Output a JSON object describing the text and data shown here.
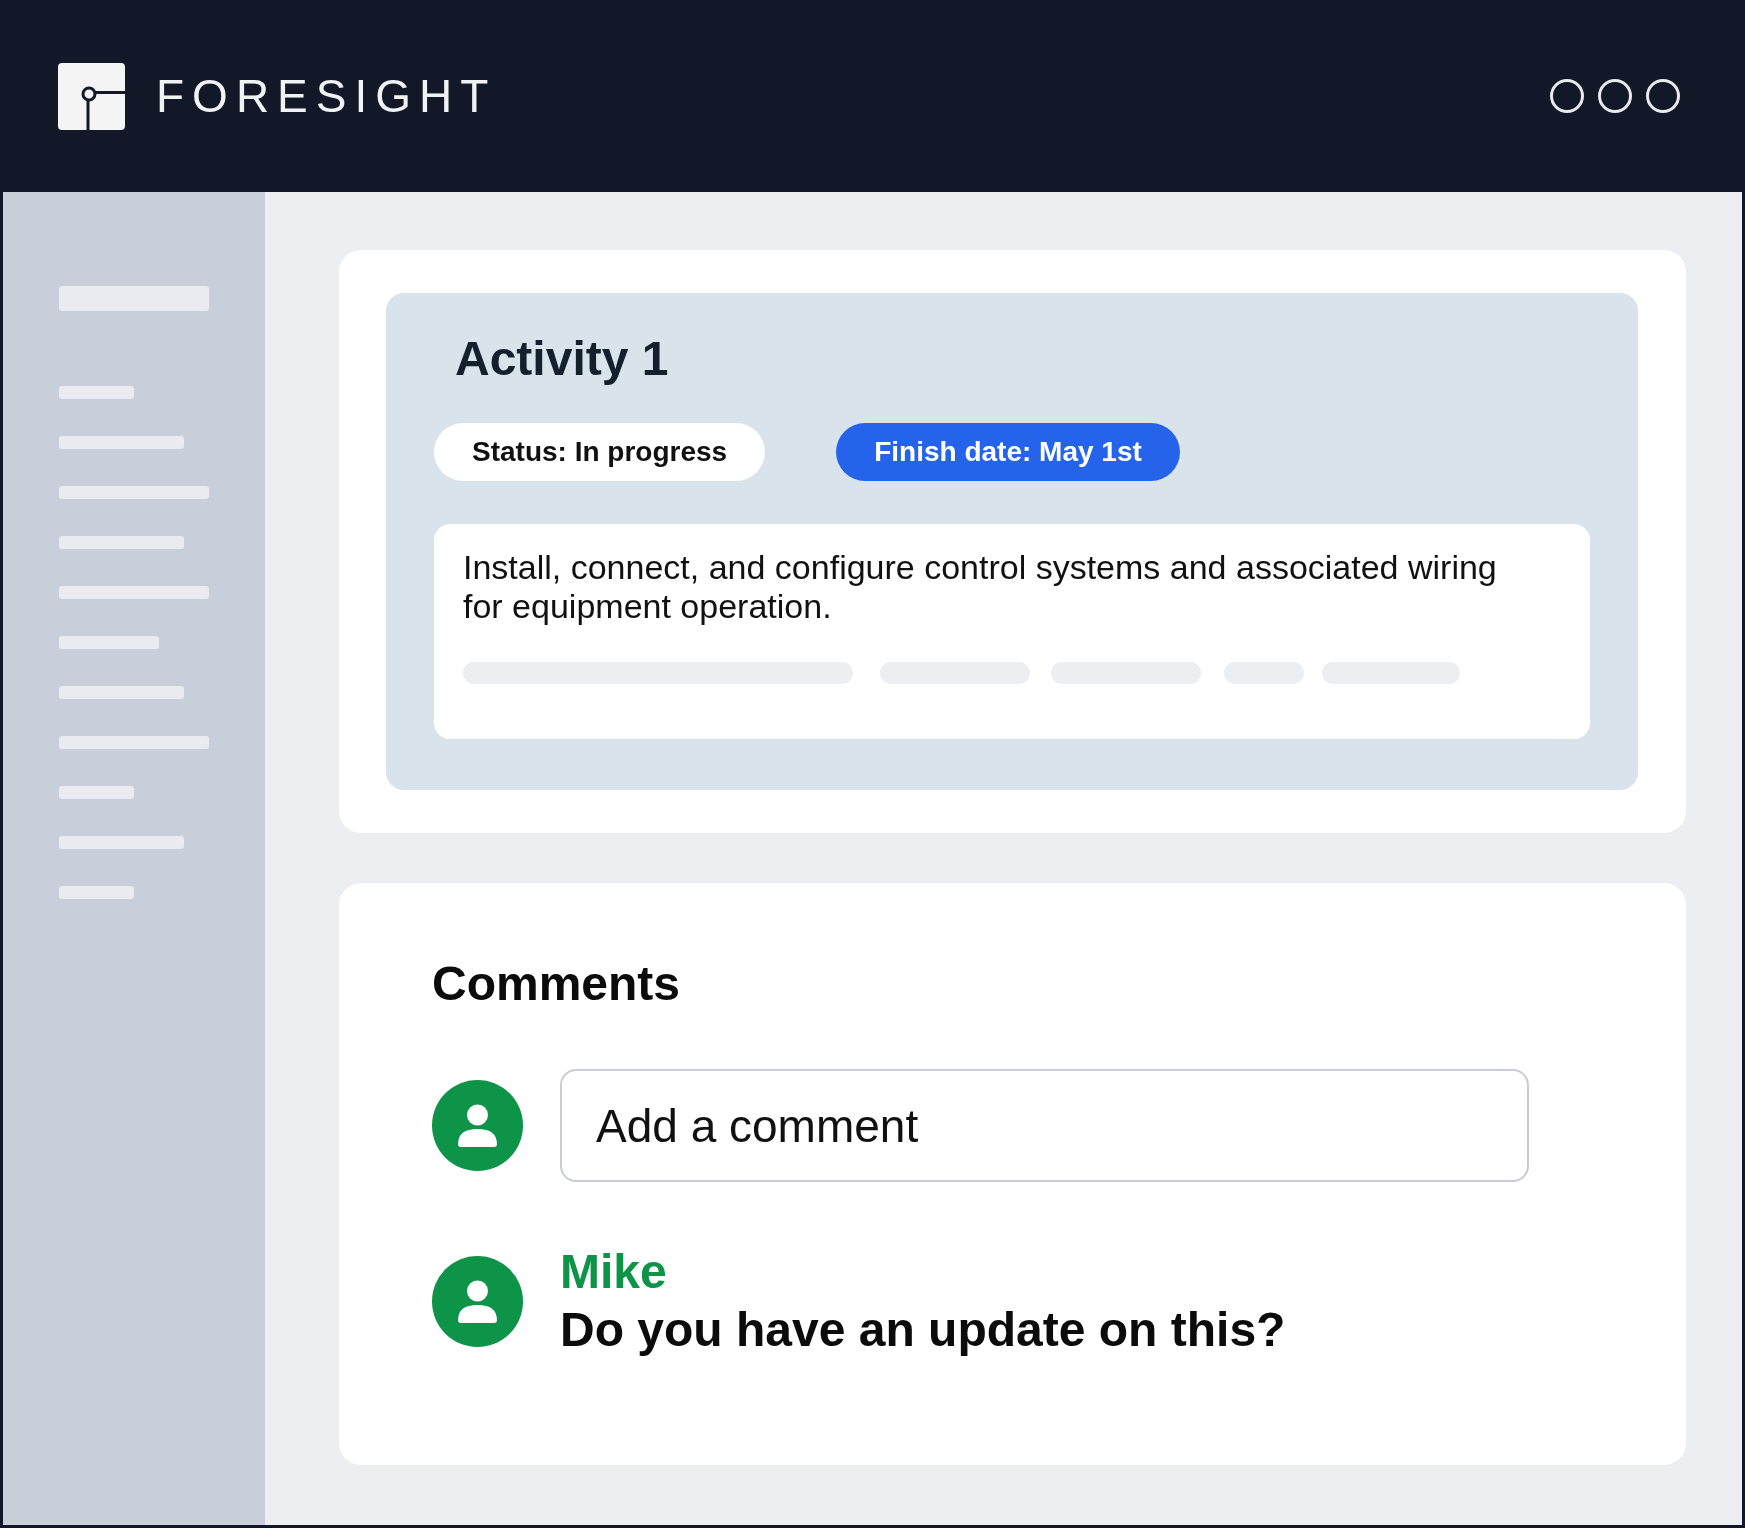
{
  "header": {
    "brand": "FORESIGHT"
  },
  "activity": {
    "title": "Activity 1",
    "badges": [
      {
        "kind": "status",
        "label": "Status: In progress"
      },
      {
        "kind": "date",
        "label": "Finish date: May 1st"
      }
    ],
    "description": "Install, connect, and configure control systems and associated wiring for equipment operation."
  },
  "comments": {
    "title": "Comments",
    "input": {
      "placeholder": "Add a comment"
    },
    "items": [
      {
        "author": "Mike",
        "text": "Do you have an update on this?"
      }
    ]
  }
}
